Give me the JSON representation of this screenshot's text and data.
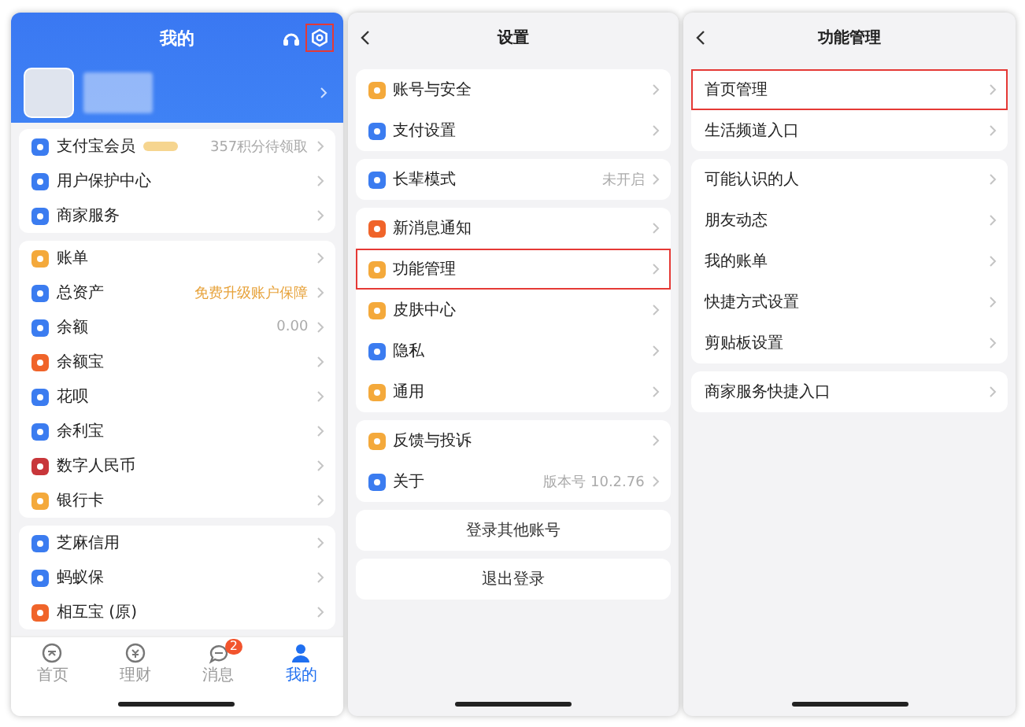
{
  "profile_screen": {
    "title": "我的",
    "settings_highlighted": true,
    "groups": [
      [
        {
          "label": "支付宝会员",
          "color": "#3b7cf0",
          "tag": true,
          "value": "357积分待领取",
          "promo": false
        },
        {
          "label": "用户保护中心",
          "color": "#3b7cf0"
        },
        {
          "label": "商家服务",
          "color": "#3b7cf0"
        }
      ],
      [
        {
          "label": "账单",
          "color": "#f4a93b"
        },
        {
          "label": "总资产",
          "color": "#3b7cf0",
          "value": "免费升级账户保障",
          "promo": true
        },
        {
          "label": "余额",
          "color": "#3b7cf0",
          "value": "0.00",
          "promo": false
        },
        {
          "label": "余额宝",
          "color": "#f0642a"
        },
        {
          "label": "花呗",
          "color": "#3b7cf0"
        },
        {
          "label": "余利宝",
          "color": "#3b7cf0"
        },
        {
          "label": "数字人民币",
          "color": "#c8363a"
        },
        {
          "label": "银行卡",
          "color": "#f4a93b"
        }
      ],
      [
        {
          "label": "芝麻信用",
          "color": "#3b7cf0"
        },
        {
          "label": "蚂蚁保",
          "color": "#3b7cf0"
        },
        {
          "label": "相互宝 (原)",
          "color": "#f0642a"
        }
      ]
    ],
    "tabs": [
      {
        "label": "首页",
        "selected": false
      },
      {
        "label": "理财",
        "selected": false
      },
      {
        "label": "消息",
        "selected": false,
        "badge": "2"
      },
      {
        "label": "我的",
        "selected": true
      }
    ]
  },
  "settings_screen": {
    "title": "设置",
    "groups": [
      [
        {
          "label": "账号与安全",
          "color": "#f4a93b",
          "highlighted": false
        },
        {
          "label": "支付设置",
          "color": "#3b7cf0",
          "highlighted": false
        }
      ],
      [
        {
          "label": "长辈模式",
          "color": "#3b7cf0",
          "value": "未开启",
          "highlighted": false
        }
      ],
      [
        {
          "label": "新消息通知",
          "color": "#f0642a",
          "highlighted": false
        },
        {
          "label": "功能管理",
          "color": "#f4a93b",
          "highlighted": true
        },
        {
          "label": "皮肤中心",
          "color": "#f4a93b",
          "highlighted": false
        },
        {
          "label": "隐私",
          "color": "#3b7cf0",
          "highlighted": false
        },
        {
          "label": "通用",
          "color": "#f4a93b",
          "highlighted": false
        }
      ],
      [
        {
          "label": "反馈与投诉",
          "color": "#f4a93b",
          "highlighted": false
        },
        {
          "label": "关于",
          "color": "#3b7cf0",
          "value": "版本号 10.2.76",
          "highlighted": false
        }
      ]
    ],
    "buttons": [
      "登录其他账号",
      "退出登录"
    ]
  },
  "feature_screen": {
    "title": "功能管理",
    "groups": [
      [
        {
          "label": "首页管理",
          "highlighted": true
        },
        {
          "label": "生活频道入口",
          "highlighted": false
        }
      ],
      [
        {
          "label": "可能认识的人",
          "highlighted": false
        },
        {
          "label": "朋友动态",
          "highlighted": false
        },
        {
          "label": "我的账单",
          "highlighted": false
        },
        {
          "label": "快捷方式设置",
          "highlighted": false
        },
        {
          "label": "剪贴板设置",
          "highlighted": false
        }
      ],
      [
        {
          "label": "商家服务快捷入口",
          "highlighted": false
        }
      ]
    ]
  }
}
